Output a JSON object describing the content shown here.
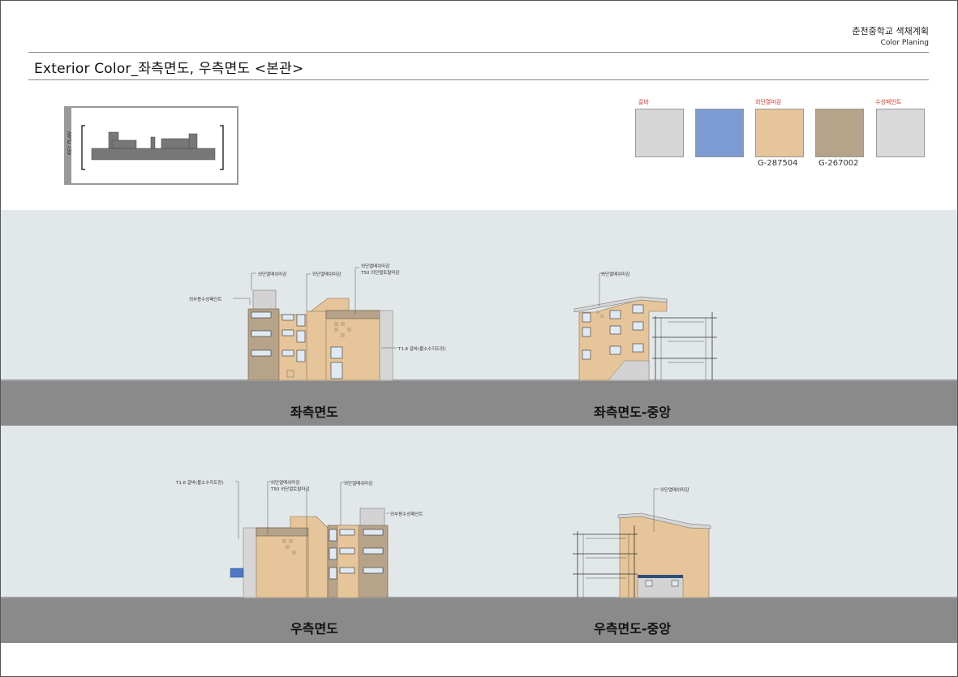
{
  "header": {
    "school": "춘천중학교 색채계획",
    "subtitle": "Color Planing",
    "title": "Exterior Color_좌측면도, 우측면도  <본관>"
  },
  "key_plan": {
    "label": "KEY PLAN"
  },
  "swatches": [
    {
      "label": "갈바",
      "code": "",
      "color": "#d6d6d6"
    },
    {
      "label": "",
      "code": "",
      "color": "#7b9bd2"
    },
    {
      "label": "외단열마감",
      "code": "G-287504",
      "color": "#e5c599"
    },
    {
      "label": "",
      "code": "G-267002",
      "color": "#b6a38a"
    },
    {
      "label": "수성페인트",
      "code": "",
      "color": "#d9d9d9"
    }
  ],
  "panels": {
    "left": {
      "caption": "좌측면도"
    },
    "left_center": {
      "caption": "좌측면도-중앙"
    },
    "right": {
      "caption": "우측면도"
    },
    "right_center": {
      "caption": "우측면도-중앙"
    }
  },
  "annotations": {
    "l_outer_paint": "외부용수성페인트",
    "l_insul1": "외단열메쉬마감",
    "l_insul2": "외단열메쉬마감",
    "l_insul3": "외단열메쉬마감",
    "l_t50": "T50 외단열토탈마감",
    "l_galva": "T1.6 갈바(불소수지도장)",
    "lc_insul": "외단열메쉬마감",
    "r_galva": "T1.6 갈바(불소수지도장)",
    "r_insul1": "외단열메쉬마감",
    "r_t50": "T50 외단열토탈마감",
    "r_insul2": "외단열메쉬마감",
    "r_outer_paint": "외부용수성페인트",
    "rc_insul": "외단열메쉬마감"
  }
}
